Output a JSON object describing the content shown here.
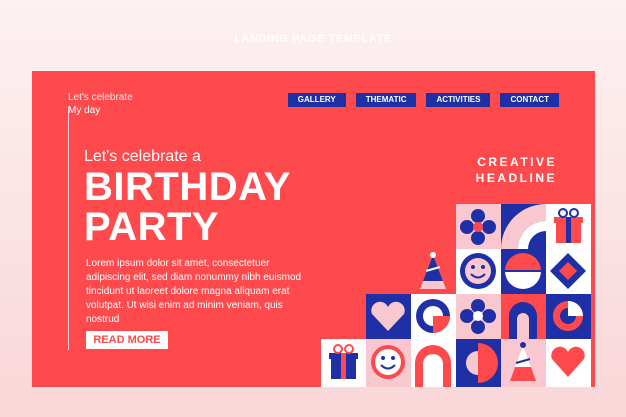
{
  "header_caption": "LANDING PAGE TEMPLATE",
  "logo": {
    "line1": "Let's celebrate",
    "line2": "My day"
  },
  "nav": [
    {
      "label": "GALLERY"
    },
    {
      "label": "THEMATIC"
    },
    {
      "label": "ACTIVITIES"
    },
    {
      "label": "CONTACT"
    }
  ],
  "hero": {
    "subtitle": "Let's celebrate a",
    "title_line1": "BIRTHDAY",
    "title_line2": "PARTY",
    "body": "Lorem ipsum dolor sit amet, consectetuer adipiscing elit, sed diam nonummy nibh euismod tincidunt ut laoreet dolore magna aliquam erat volutpat. Ut wisi enim ad minim veniam, quis nostrud",
    "cta": "READ MORE"
  },
  "creative": {
    "line1": "CREATIVE",
    "line2": "HEADLINE"
  },
  "colors": {
    "background": "#ff4a4d",
    "navy": "#1f30a6",
    "pink": "#f9c7d0",
    "white": "#ffffff"
  }
}
